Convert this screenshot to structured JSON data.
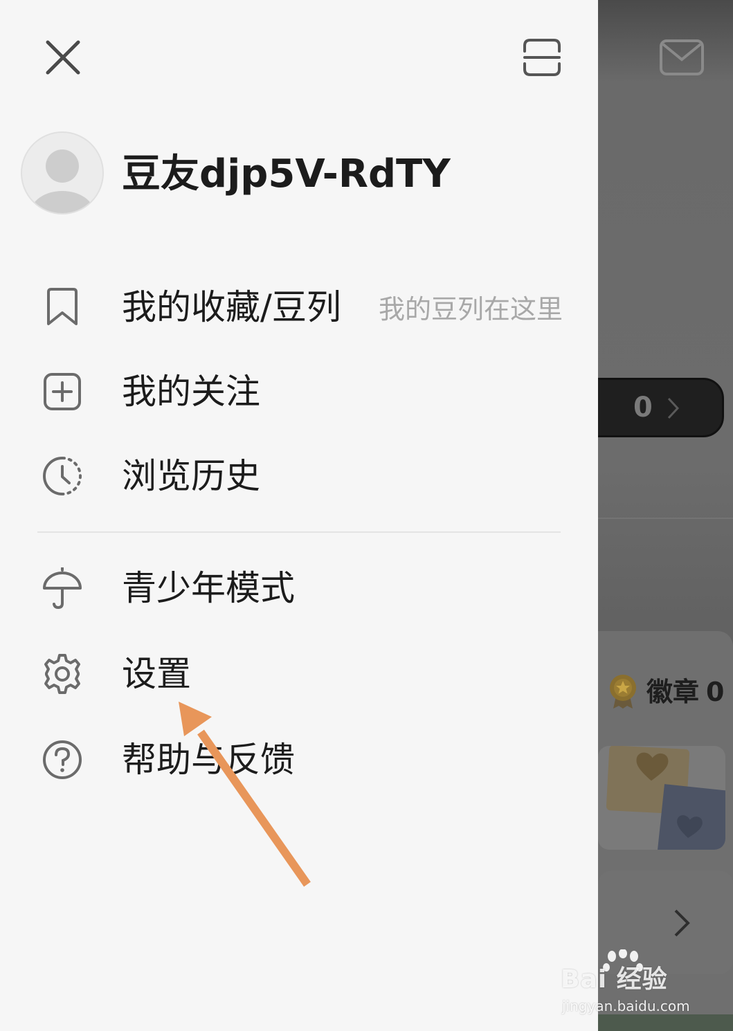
{
  "drawer": {
    "username": "豆友djp5V-RdTY",
    "menu": [
      {
        "label": "我的收藏/豆列",
        "hint": "我的豆列在这里",
        "icon": "bookmark-icon"
      },
      {
        "label": "我的关注",
        "icon": "add-box-icon"
      },
      {
        "label": "浏览历史",
        "icon": "history-clock-icon"
      },
      {
        "label": "青少年模式",
        "icon": "umbrella-icon"
      },
      {
        "label": "设置",
        "icon": "gear-icon"
      },
      {
        "label": "帮助与反馈",
        "icon": "help-circle-icon"
      }
    ]
  },
  "background": {
    "count_value": "0",
    "badge_label": "徽章",
    "badge_count": "0"
  },
  "watermark": {
    "logo": "Bai 经验",
    "url": "jingyan.baidu.com"
  },
  "colors": {
    "drawer_bg": "#f6f6f6",
    "text_primary": "#1c1c1c",
    "text_hint": "#a8a8a8",
    "icon_gray": "#6b6b6b",
    "annotation_arrow": "#e8965a"
  }
}
